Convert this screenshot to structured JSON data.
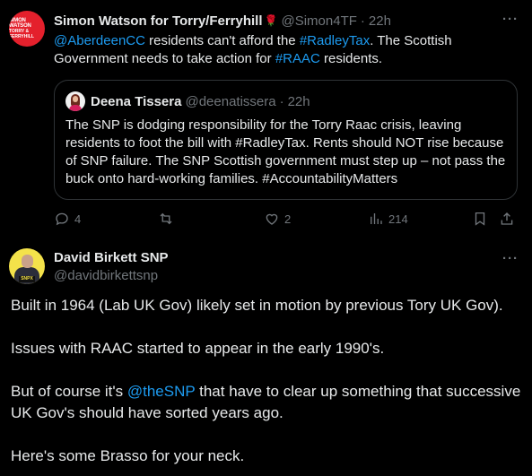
{
  "tweet1": {
    "avatar_text_line1": "SIMON WATSON",
    "avatar_text_line2": "TORRY & FERRYHILL",
    "display_name": "Simon Watson for Torry/Ferryhill",
    "name_emoji": "🌹",
    "handle": "@Simon4TF",
    "separator": "·",
    "time": "22h",
    "more": "···",
    "text_parts": [
      {
        "text": "@AberdeenCC",
        "link": true
      },
      {
        "text": " residents can't afford the ",
        "link": false
      },
      {
        "text": "#RadleyTax",
        "link": true
      },
      {
        "text": ". The Scottish Government needs to take action for ",
        "link": false
      },
      {
        "text": "#RAAC",
        "link": true
      },
      {
        "text": " residents.",
        "link": false
      }
    ],
    "quote": {
      "display_name": "Deena Tissera",
      "handle": "@deenatissera",
      "separator": "·",
      "time": "22h",
      "text": "The SNP is dodging responsibility for the Torry Raac crisis, leaving residents to foot the bill with #RadleyTax. Rents should NOT rise because of SNP failure. The SNP Scottish government must step up – not pass the buck onto hard-working families. #AccountabilityMatters"
    },
    "actions": {
      "replies": "4",
      "retweets": "",
      "likes": "2",
      "views": "214"
    }
  },
  "tweet2": {
    "avatar_badge": "SNPX",
    "display_name": "David Birkett SNP",
    "handle": "@davidbirkettsnp",
    "more": "···",
    "para1": "Built in 1964 (Lab UK Gov) likely set in motion by previous Tory UK Gov).",
    "para2": "Issues with RAAC started to appear in the early 1990's.",
    "para3_before": "But of course it's ",
    "para3_link": "@theSNP",
    "para3_after": " that have to clear up something that successive UK Gov's should have sorted years ago.",
    "para4": "Here's some Brasso for your neck."
  },
  "colors": {
    "background": "#000000",
    "text": "#e7e9ea",
    "muted": "#71767b",
    "link": "#1d9bf0",
    "border": "#2f3336"
  }
}
